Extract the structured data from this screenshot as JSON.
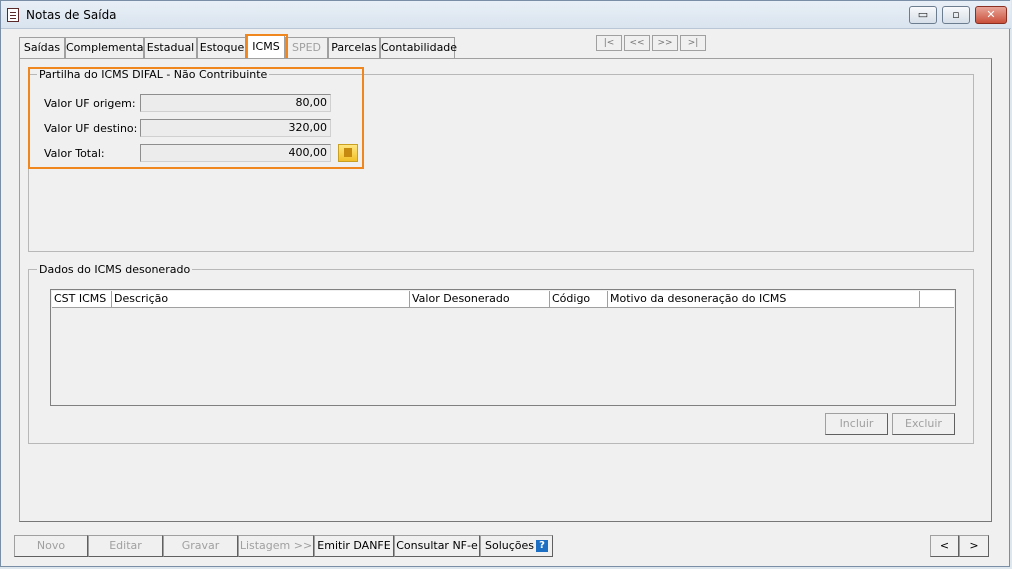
{
  "window": {
    "title": "Notas de Saída",
    "min_label": "▭",
    "max_label": "▫",
    "close_label": "✕"
  },
  "tabs": [
    {
      "label": "Saídas"
    },
    {
      "label": "Complementar"
    },
    {
      "label": "Estadual"
    },
    {
      "label": "Estoque"
    },
    {
      "label": "ICMS"
    },
    {
      "label": "SPED"
    },
    {
      "label": "Parcelas"
    },
    {
      "label": "Contabilidade"
    }
  ],
  "record_nav": {
    "first": "|<",
    "prev": "<<",
    "next": ">>",
    "last": ">|"
  },
  "partilha": {
    "legend": "Partilha do ICMS DIFAL - Não Contribuinte",
    "uf_origem_label": "Valor UF origem:",
    "uf_origem_value": "80,00",
    "uf_destino_label": "Valor UF destino:",
    "uf_destino_value": "320,00",
    "total_label": "Valor Total:",
    "total_value": "400,00"
  },
  "desonerado": {
    "legend": "Dados do ICMS desonerado",
    "columns": [
      "CST ICMS",
      "Descrição",
      "Valor Desonerado",
      "Código",
      "Motivo da desoneração do ICMS"
    ],
    "incluir_label": "Incluir",
    "excluir_label": "Excluir"
  },
  "footer": {
    "novo": "Novo",
    "editar": "Editar",
    "gravar": "Gravar",
    "listagem": "Listagem >>",
    "emitir": "Emitir DANFE",
    "consultar": "Consultar NF-e",
    "solucoes": "Soluções",
    "help_glyph": "?",
    "prev": "<",
    "next": ">"
  },
  "colors": {
    "highlight": "#f0861e"
  }
}
